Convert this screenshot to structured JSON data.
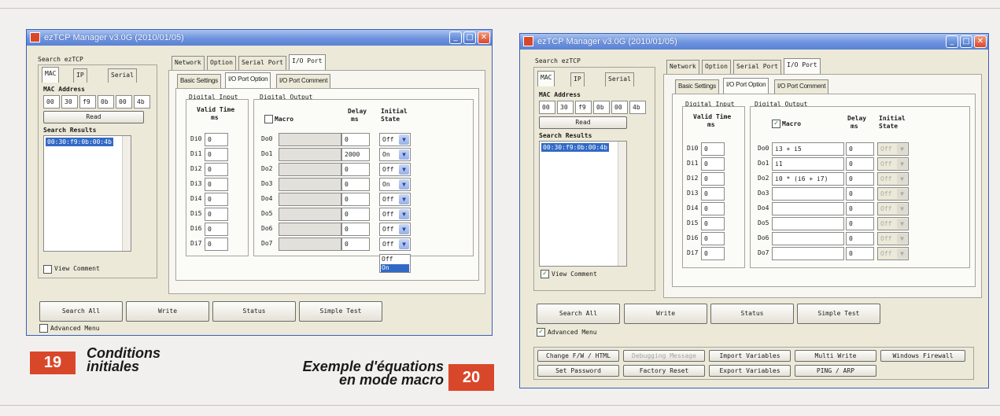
{
  "window_title": "ezTCP Manager v3.0G (2010/01/05)",
  "search_group": "Search ezTCP",
  "left_tabs": [
    "MAC",
    "IP",
    "Serial"
  ],
  "mac_label": "MAC Address",
  "mac": [
    "00",
    "30",
    "f9",
    "0b",
    "00",
    "4b"
  ],
  "read_button": "Read",
  "results_label": "Search Results",
  "result_item": "00:30:f9:0b:00:4b",
  "view_comment": "View Comment",
  "top_tabs": [
    "Network",
    "Option",
    "Serial Port",
    "I/O Port"
  ],
  "sub_tabs": [
    "Basic Settings",
    "I/O Port Option",
    "I/O Port Comment"
  ],
  "di_group": "Digital Input",
  "valid_time": "Valid Time",
  "unit_ms": "ms",
  "do_group": "Digital Output",
  "macro_label": "Macro",
  "delay_label": "Delay",
  "initial_label": "Initial",
  "state_label": "State",
  "di_labels": [
    "Di0",
    "Di1",
    "Di2",
    "Di3",
    "Di4",
    "Di5",
    "Di6",
    "Di7"
  ],
  "do_labels": [
    "Do0",
    "Do1",
    "Do2",
    "Do3",
    "Do4",
    "Do5",
    "Do6",
    "Do7"
  ],
  "bottom_buttons": [
    "Search All",
    "Write",
    "Status",
    "Simple Test"
  ],
  "advanced_menu": "Advanced Menu",
  "left_panel": {
    "di_values": [
      "0",
      "0",
      "0",
      "0",
      "0",
      "0",
      "0",
      "0"
    ],
    "delays": [
      "0",
      "2000",
      "0",
      "0",
      "0",
      "0",
      "0",
      "0"
    ],
    "states": [
      "Off",
      "On",
      "Off",
      "On",
      "Off",
      "Off",
      "Off",
      "Off"
    ],
    "dropdown_options": [
      "Off",
      "On"
    ],
    "caption_number": "19",
    "caption_line1": "Conditions",
    "caption_line2": "initiales"
  },
  "right_panel": {
    "di_values": [
      "0",
      "0",
      "0",
      "0",
      "0",
      "0",
      "0",
      "0"
    ],
    "macros": [
      "i3 + i5",
      "i1",
      "i0 * (i6 + i7)",
      "",
      "",
      "",
      "",
      ""
    ],
    "delays": [
      "0",
      "0",
      "0",
      "0",
      "0",
      "0",
      "0",
      "0"
    ],
    "states": [
      "Off",
      "Off",
      "Off",
      "Off",
      "Off",
      "Off",
      "Off",
      "Off"
    ],
    "advanced_buttons": [
      "Change F/W / HTML",
      "Debugging Message",
      "Import Variables",
      "Multi Write",
      "Windows Firewall",
      "Set Password",
      "Factory Reset",
      "Export Variables",
      "PING / ARP"
    ],
    "caption_number": "20",
    "caption_line1": "Exemple d'équations",
    "caption_line2": "en mode macro"
  },
  "colors": {
    "badge": "#d9472a",
    "titlebar": "#6d93de",
    "selection": "#316ac5"
  }
}
